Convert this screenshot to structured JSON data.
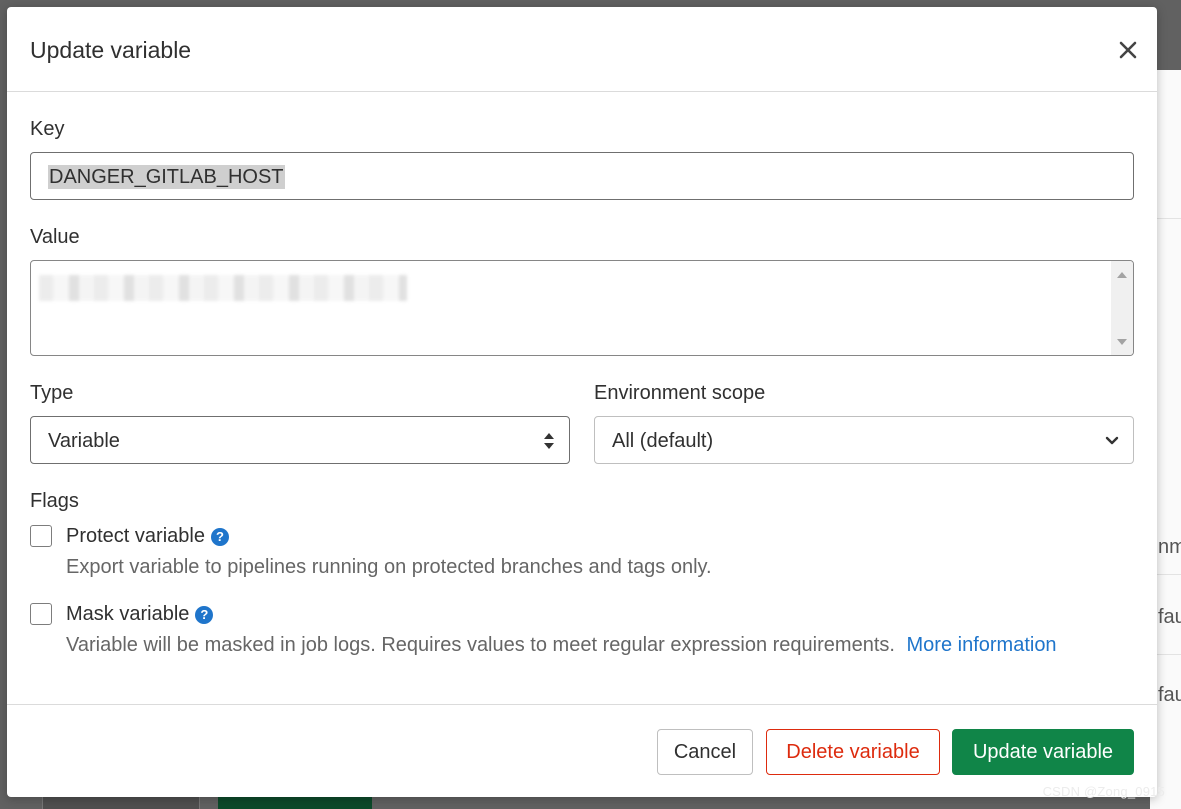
{
  "modal": {
    "title": "Update variable",
    "close_icon": "close-icon"
  },
  "key": {
    "label": "Key",
    "value": "DANGER_GITLAB_HOST"
  },
  "value": {
    "label": "Value"
  },
  "type": {
    "label": "Type",
    "selected": "Variable",
    "icon": "sort-arrows-icon"
  },
  "environment": {
    "label": "Environment scope",
    "selected": "All (default)",
    "icon": "chevron-down-icon"
  },
  "flags": {
    "label": "Flags",
    "protect": {
      "label": "Protect variable",
      "help": "Export variable to pipelines running on protected branches and tags only.",
      "checked": false
    },
    "mask": {
      "label": "Mask variable",
      "help": "Variable will be masked in job logs. Requires values to meet regular expression requirements.",
      "link": "More information",
      "checked": false
    },
    "help_icon": "question-circle-icon"
  },
  "footer": {
    "cancel": "Cancel",
    "delete": "Delete variable",
    "update": "Update variable"
  },
  "background": {
    "row1": "nm",
    "row2": "fau",
    "row3": "fau"
  },
  "watermark": "CSDN @Zong_0915",
  "colors": {
    "primary_green": "#108548",
    "danger_red": "#dd2b0e",
    "link_blue": "#1f75cb",
    "overlay": "#616161"
  }
}
